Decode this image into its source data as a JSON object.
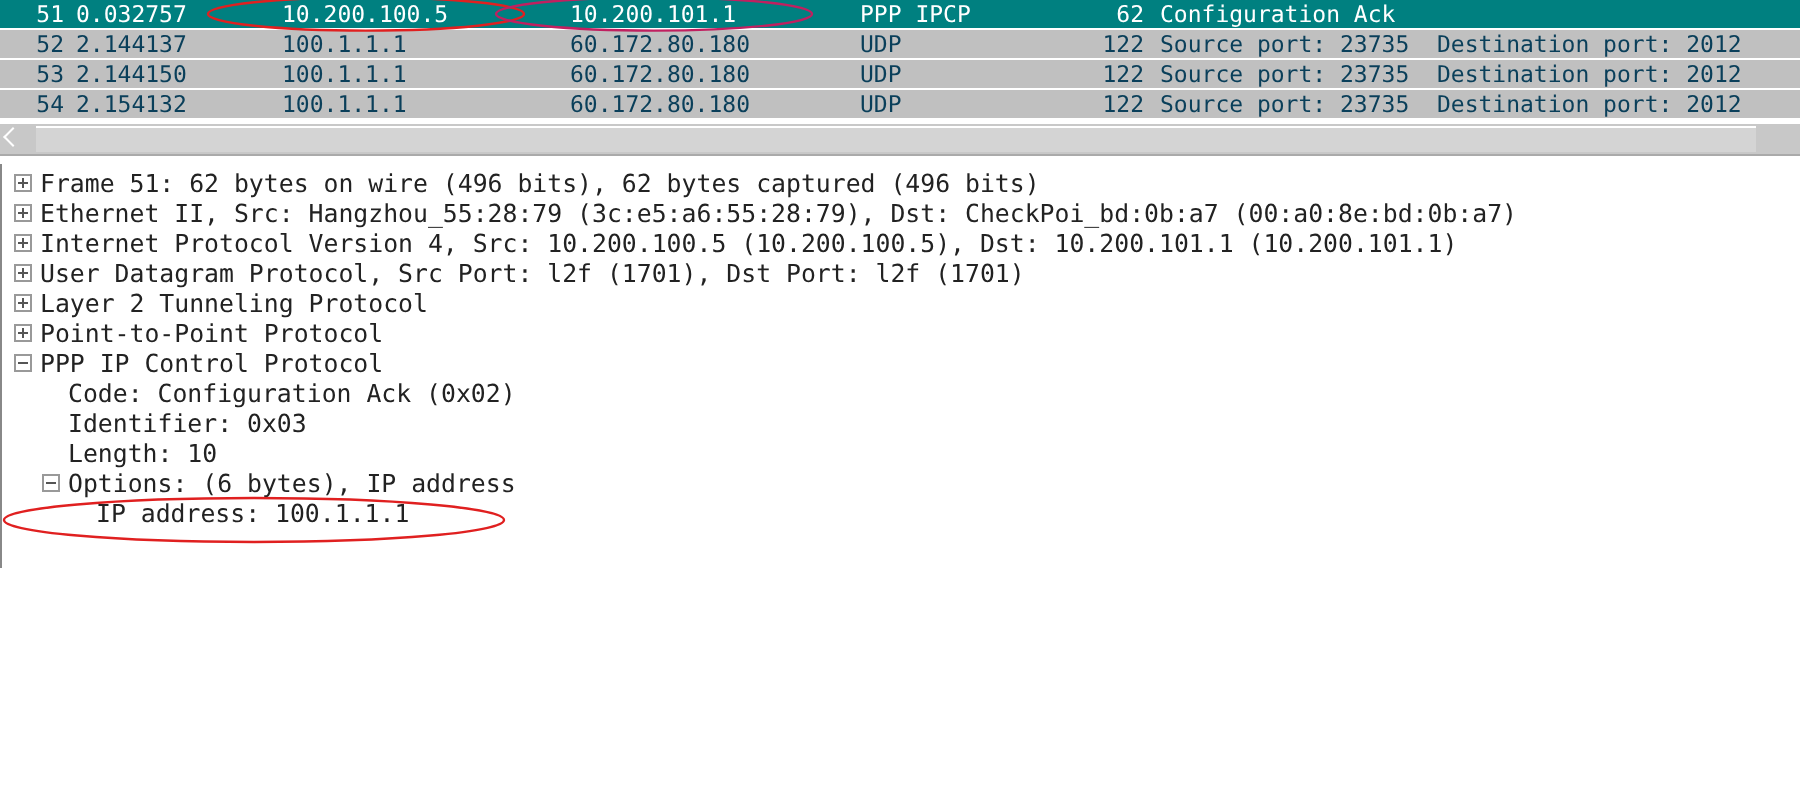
{
  "packet_list": {
    "rows": [
      {
        "no": "51",
        "time": "0.032757",
        "source": "10.200.100.5",
        "destination": "10.200.101.1",
        "protocol": "PPP IPCP",
        "length": "62",
        "info": "Configuration Ack",
        "selected": true
      },
      {
        "no": "52",
        "time": "2.144137",
        "source": "100.1.1.1",
        "destination": "60.172.80.180",
        "protocol": "UDP",
        "length": "122",
        "info": "Source port: 23735  Destination port: 2012",
        "selected": false
      },
      {
        "no": "53",
        "time": "2.144150",
        "source": "100.1.1.1",
        "destination": "60.172.80.180",
        "protocol": "UDP",
        "length": "122",
        "info": "Source port: 23735  Destination port: 2012",
        "selected": false
      },
      {
        "no": "54",
        "time": "2.154132",
        "source": "100.1.1.1",
        "destination": "60.172.80.180",
        "protocol": "UDP",
        "length": "122",
        "info": "Source port: 23735  Destination port: 2012",
        "selected": false
      }
    ]
  },
  "details": {
    "items": [
      {
        "label": "Frame 51: 62 bytes on wire (496 bits), 62 bytes captured (496 bits)",
        "expanded": false
      },
      {
        "label": "Ethernet II, Src: Hangzhou_55:28:79 (3c:e5:a6:55:28:79), Dst: CheckPoi_bd:0b:a7 (00:a0:8e:bd:0b:a7)",
        "expanded": false
      },
      {
        "label": "Internet Protocol Version 4, Src: 10.200.100.5 (10.200.100.5), Dst: 10.200.101.1 (10.200.101.1)",
        "expanded": false
      },
      {
        "label": "User Datagram Protocol, Src Port: l2f (1701), Dst Port: l2f (1701)",
        "expanded": false
      },
      {
        "label": "Layer 2 Tunneling Protocol",
        "expanded": false
      },
      {
        "label": "Point-to-Point Protocol",
        "expanded": false
      },
      {
        "label": "PPP IP Control Protocol",
        "expanded": true,
        "children": [
          {
            "label": "Code: Configuration Ack (0x02)"
          },
          {
            "label": "Identifier: 0x03"
          },
          {
            "label": "Length: 10"
          },
          {
            "label": "Options: (6 bytes), IP address",
            "expanded": true,
            "children": [
              {
                "label": "IP address: 100.1.1.1"
              }
            ]
          }
        ]
      }
    ]
  }
}
